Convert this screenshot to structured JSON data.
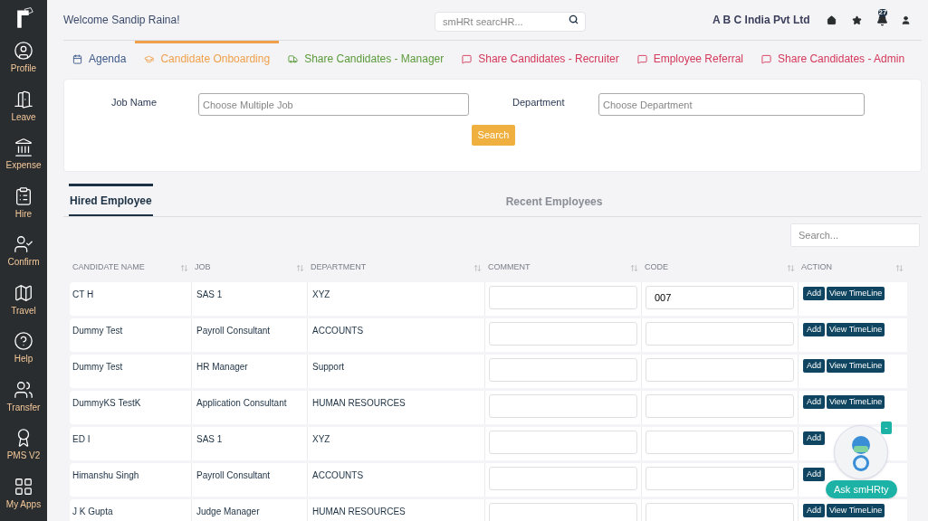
{
  "sidebar": {
    "items": [
      {
        "label": "Profile"
      },
      {
        "label": "Leave"
      },
      {
        "label": "Expense"
      },
      {
        "label": "Hire"
      },
      {
        "label": "Confirm"
      },
      {
        "label": "Travel"
      },
      {
        "label": "Help"
      },
      {
        "label": "Transfer"
      },
      {
        "label": "PMS V2"
      },
      {
        "label": "My Apps"
      }
    ]
  },
  "header": {
    "welcome": "Welcome Sandip Raina!",
    "search_placeholder": "smHRt searcHR...",
    "company": "A B C India Pvt Ltd",
    "notification_count": "27"
  },
  "tabs": [
    {
      "label": "Agenda",
      "selected": false,
      "color": "#3d5a8a"
    },
    {
      "label": "Candidate Onboarding",
      "selected": true,
      "color": "#f0a04b"
    },
    {
      "label": "Share Candidates - Manager",
      "selected": false,
      "color": "#5a9a3a"
    },
    {
      "label": "Share Candidates - Recruiter",
      "selected": false,
      "color": "#d4385a"
    },
    {
      "label": "Employee Referral",
      "selected": false,
      "color": "#d4385a"
    },
    {
      "label": "Share Candidates - Admin",
      "selected": false,
      "color": "#d4385a"
    }
  ],
  "filters": {
    "job_label": "Job Name",
    "job_placeholder": "Choose Multiple Job",
    "department_label": "Department",
    "department_placeholder": "Choose Department",
    "search_button": "Search"
  },
  "subtabs": [
    {
      "label": "Hired Employee",
      "selected": true
    },
    {
      "label": "Recent Employees",
      "selected": false
    }
  ],
  "table": {
    "search_placeholder": "Search...",
    "columns": [
      "CANDIDATE NAME",
      "JOB",
      "DEPARTMENT",
      "COMMENT",
      "CODE",
      "ACTION"
    ],
    "rows": [
      {
        "name": "CT H",
        "job": "SAS 1",
        "department": "XYZ",
        "code": "007",
        "add": "Add",
        "timeline": "View TimeLine"
      },
      {
        "name": "Dummy Test",
        "job": "Payroll Consultant",
        "department": "ACCOUNTS",
        "add": "Add",
        "timeline": "View TimeLine"
      },
      {
        "name": "Dummy Test",
        "job": "HR Manager",
        "department": "Support",
        "add": "Add",
        "timeline": "View TimeLine"
      },
      {
        "name": "DummyKS TestK",
        "job": "Application Consultant",
        "department": "HUMAN RESOURCES",
        "add": "Add",
        "timeline": "View TimeLine"
      },
      {
        "name": "ED I",
        "job": "SAS 1",
        "department": "XYZ",
        "add": "Add"
      },
      {
        "name": "Himanshu Singh",
        "job": "Payroll Consultant",
        "department": "ACCOUNTS",
        "add": "Add"
      },
      {
        "name": "J K Gupta",
        "job": "Judge Manager",
        "department": "HUMAN RESOURCES",
        "add": "Add",
        "timeline": "View TimeLine"
      }
    ]
  },
  "chatbot": {
    "label": "Ask smHRty",
    "minimize": "-"
  }
}
